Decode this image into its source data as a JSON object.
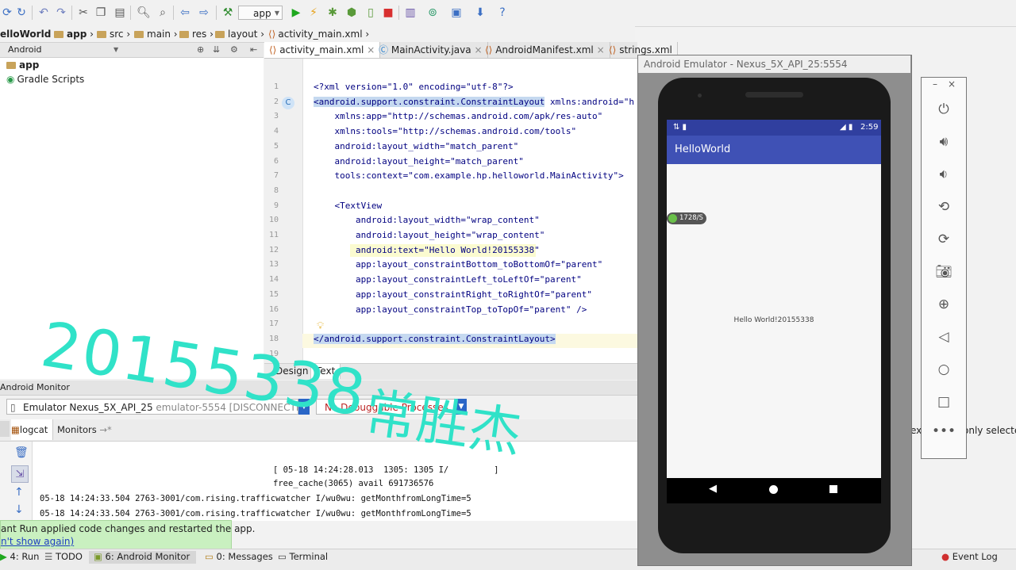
{
  "toolbar": {
    "run_config": "app"
  },
  "breadcrumb": [
    "elloWorld",
    "app",
    "src",
    "main",
    "res",
    "layout",
    "activity_main.xml"
  ],
  "project_panel": {
    "view_mode": "Android",
    "tree": [
      {
        "label": "app",
        "icon": "module-folder-icon"
      },
      {
        "label": "Gradle Scripts",
        "icon": "gradle-icon"
      }
    ]
  },
  "editor_tabs": [
    {
      "label": "activity_main.xml",
      "active": true
    },
    {
      "label": "MainActivity.java",
      "active": false
    },
    {
      "label": "AndroidManifest.xml",
      "active": false
    },
    {
      "label": "strings.xml",
      "active": false
    }
  ],
  "code_lines": [
    {
      "n": "1",
      "text": "<?xml version=\"1.0\" encoding=\"utf-8\"?>"
    },
    {
      "n": "2",
      "text": "<android.support.constraint.ConstraintLayout xmlns:android=\"h"
    },
    {
      "n": "3",
      "text": "    xmlns:app=\"http://schemas.android.com/apk/res-auto\""
    },
    {
      "n": "4",
      "text": "    xmlns:tools=\"http://schemas.android.com/tools\""
    },
    {
      "n": "5",
      "text": "    android:layout_width=\"match_parent\""
    },
    {
      "n": "6",
      "text": "    android:layout_height=\"match_parent\""
    },
    {
      "n": "7",
      "text": "    tools:context=\"com.example.hp.helloworld.MainActivity\">"
    },
    {
      "n": "8",
      "text": ""
    },
    {
      "n": "9",
      "text": "    <TextView"
    },
    {
      "n": "10",
      "text": "        android:layout_width=\"wrap_content\""
    },
    {
      "n": "11",
      "text": "        android:layout_height=\"wrap_content\""
    },
    {
      "n": "12",
      "text": "        android:text=\"Hello World!20155338\""
    },
    {
      "n": "13",
      "text": "        app:layout_constraintBottom_toBottomOf=\"parent\""
    },
    {
      "n": "14",
      "text": "        app:layout_constraintLeft_toLeftOf=\"parent\""
    },
    {
      "n": "15",
      "text": "        app:layout_constraintRight_toRightOf=\"parent\""
    },
    {
      "n": "16",
      "text": "        app:layout_constraintTop_toTopOf=\"parent\" />"
    },
    {
      "n": "17",
      "text": ""
    },
    {
      "n": "18",
      "text": "</android.support.constraint.ConstraintLayout>"
    },
    {
      "n": "19",
      "text": ""
    }
  ],
  "design_text_tabs": {
    "design": "Design",
    "text": "Text"
  },
  "monitor": {
    "title": "Android Monitor",
    "device": "Emulator Nexus_5X_API_25",
    "device_detail": "emulator-5554 [DISCONNECTED]",
    "process": "No Debuggable Processes",
    "tab_logcat": "logcat",
    "tab_monitors": "Monitors",
    "right_text_1": "ex",
    "right_text_2": "only selected"
  },
  "log_lines": [
    "[ 05-18 14:24:28.013  1305: 1305 I/         ]",
    "free_cache(3065) avail 691736576",
    "05-18 14:24:33.504 2763-3001/com.rising.trafficwatcher I/wu0wu: getMonthfromLongTime=5",
    "05-18 14:24:33.504 2763-3001/com.rising.trafficwatcher I/wu0wu: getMonthfromLongTime=5"
  ],
  "notice": {
    "line1": "ant Run applied code changes and restarted the app.",
    "line2": "n't show again)"
  },
  "status_bar": {
    "run": "4: Run",
    "todo": "TODO",
    "monitor": "6: Android Monitor",
    "messages": "0: Messages",
    "terminal": "Terminal",
    "event_log": "Event Log"
  },
  "emulator": {
    "title": "Android Emulator - Nexus_5X_API_25:5554",
    "time": "2:59",
    "app_title": "HelloWorld",
    "speed_badge": "1728/S",
    "hello_text": "Hello World!20155338"
  },
  "watermark": {
    "line1": "20155338",
    "line2": "常胜杰"
  },
  "colors": {
    "accent_teal": "#30e2c8",
    "app_bar": "#3f51b5",
    "status_bar": "#303f9f"
  }
}
